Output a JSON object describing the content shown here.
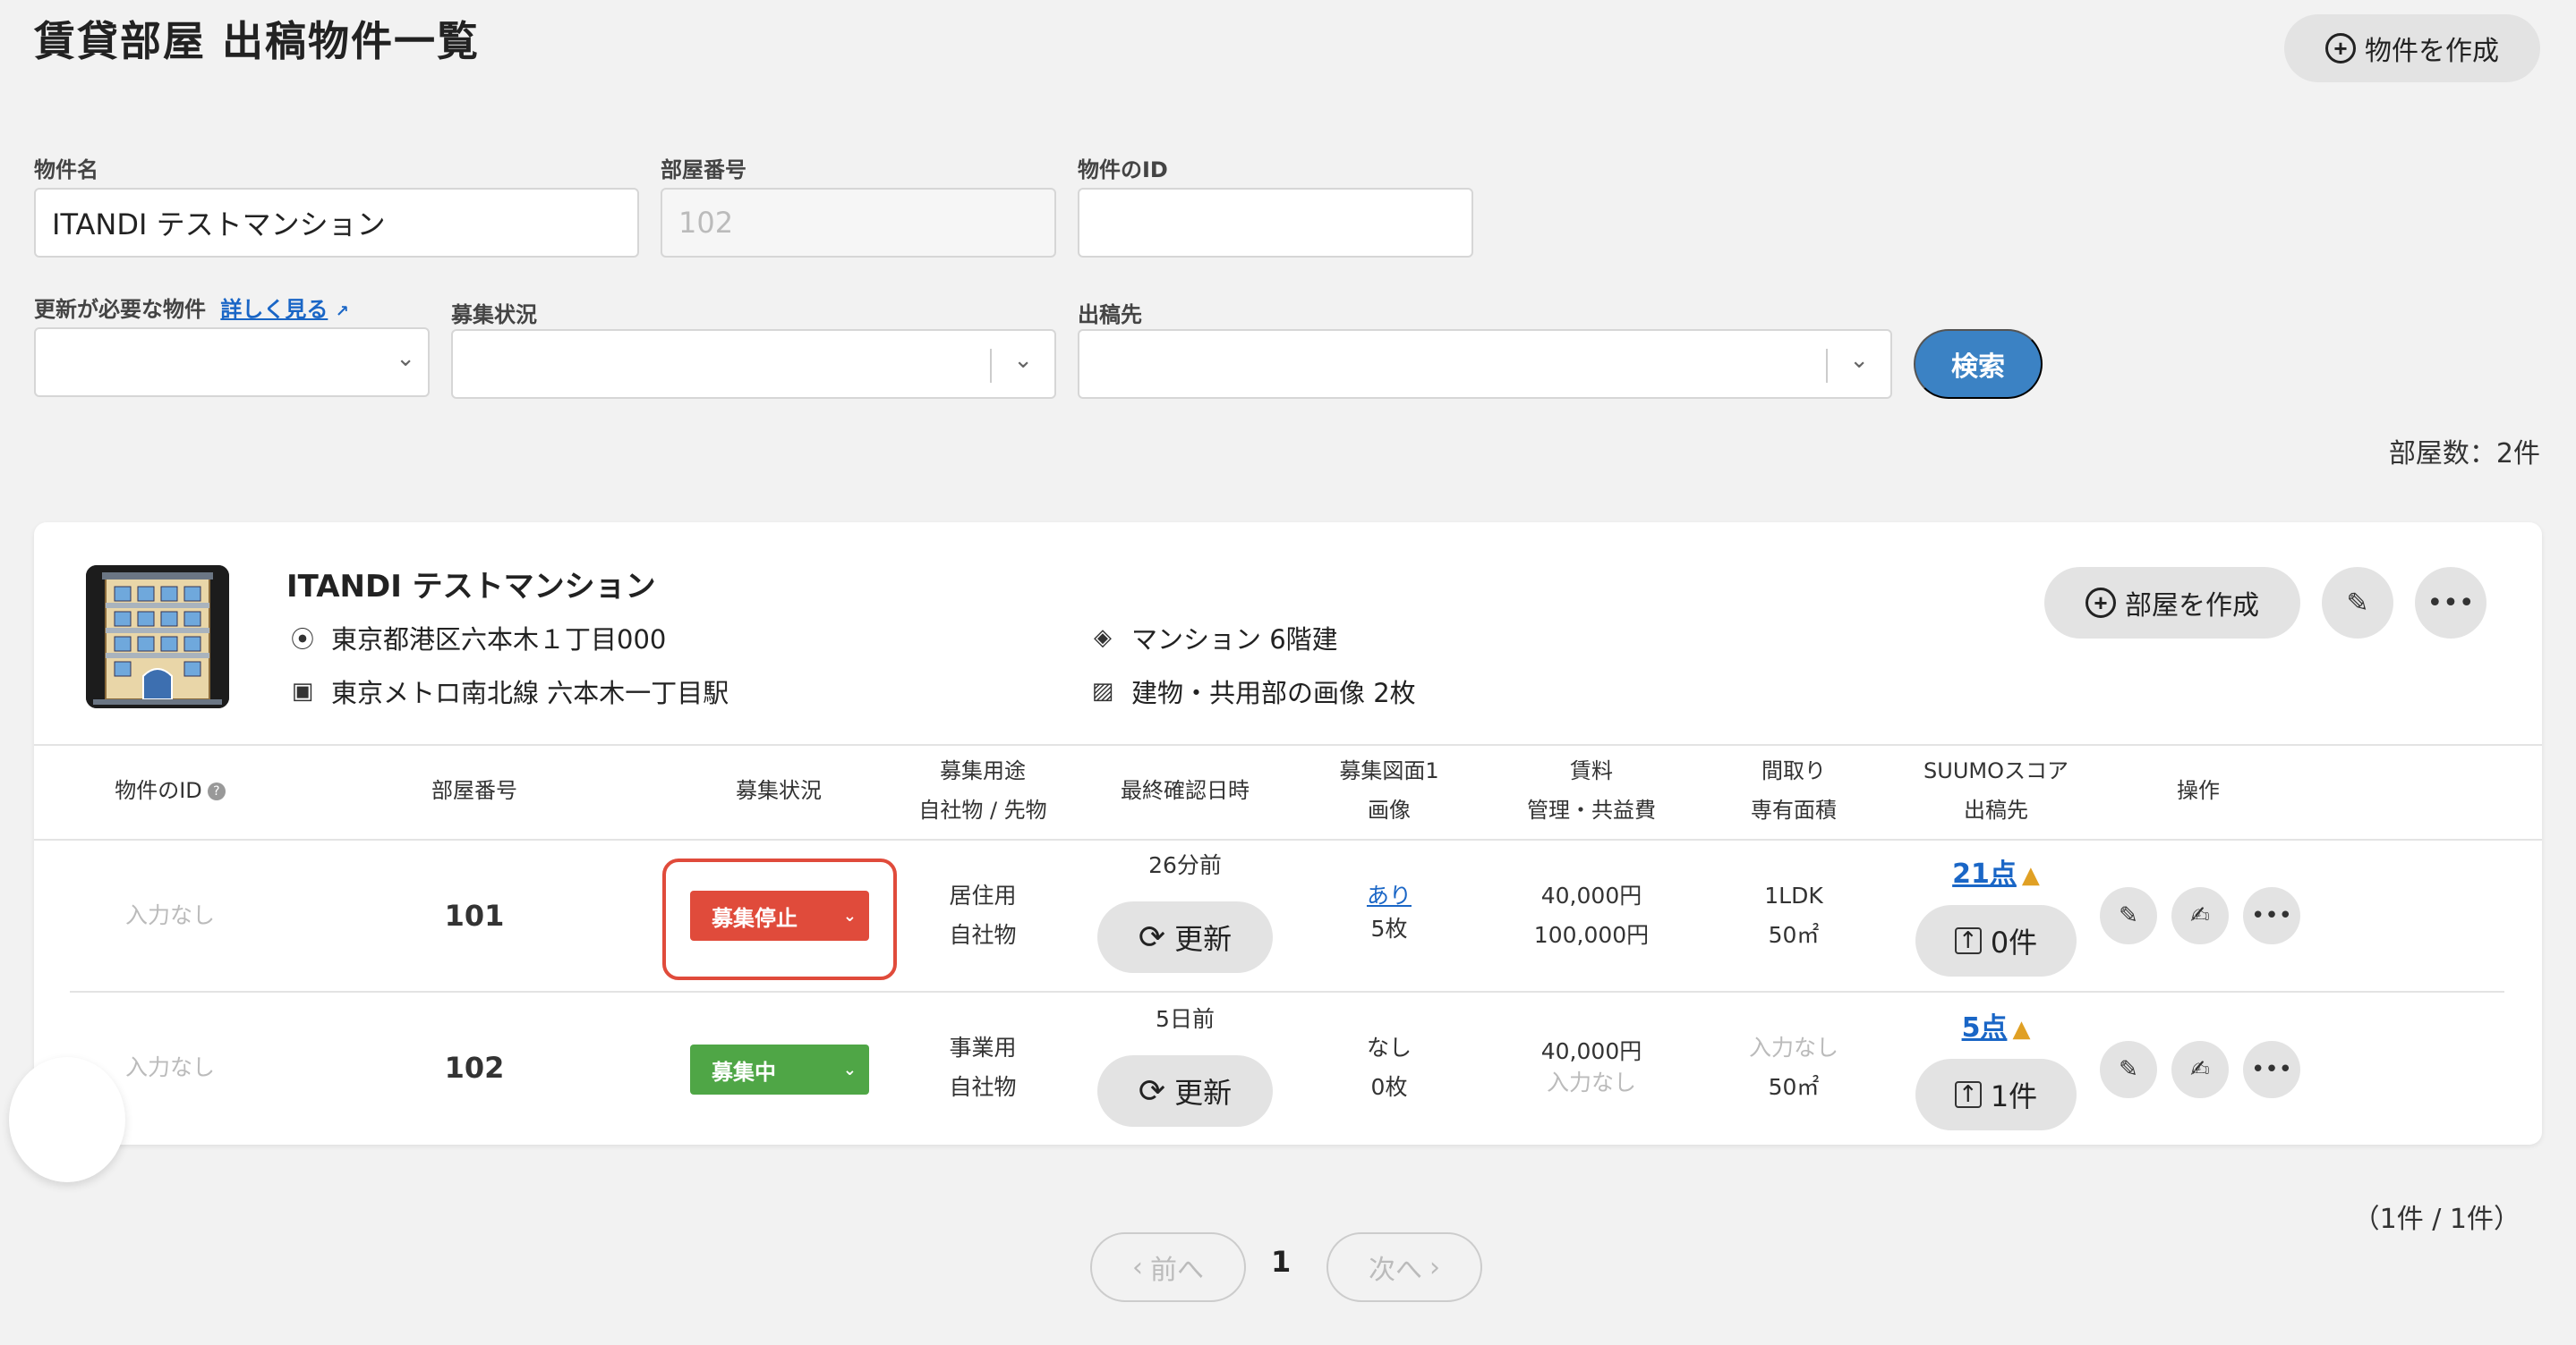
{
  "header": {
    "title": "賃貸部屋 出稿物件一覧",
    "create_property_label": "物件を作成"
  },
  "filters": {
    "property_name_label": "物件名",
    "property_name_value": "ITANDI テストマンション",
    "room_number_label": "部屋番号",
    "room_number_placeholder": "102",
    "property_id_label": "物件のID",
    "property_id_value": "",
    "needs_update_label": "更新が必要な物件",
    "details_link": "詳しく見る",
    "recruit_status_label": "募集状況",
    "publish_to_label": "出稿先",
    "search_label": "検索"
  },
  "room_count": "部屋数：2件",
  "property": {
    "name": "ITANDI テストマンション",
    "address": "東京都港区六本木１丁目000",
    "station": "東京メトロ南北線 六本木一丁目駅",
    "building_type": "マンション 6階建",
    "images": "建物・共用部の画像 2枚",
    "create_room_label": "部屋を作成"
  },
  "table": {
    "headers": {
      "property_id": "物件のID",
      "room_number": "部屋番号",
      "status": "募集状況",
      "usage_1": "募集用途",
      "usage_2": "自社物 / 先物",
      "last_checked": "最終確認日時",
      "floorplan_1": "募集図面1",
      "floorplan_2": "画像",
      "rent_1": "賃料",
      "rent_2": "管理・共益費",
      "layout_1": "間取り",
      "layout_2": "専有面積",
      "suumo_1": "SUUMOスコア",
      "suumo_2": "出稿先",
      "actions": "操作"
    },
    "rows": [
      {
        "property_id": "入力なし",
        "room_number": "101",
        "status": "募集停止",
        "usage": "居住用",
        "ownership": "自社物",
        "last_checked": "26分前",
        "update_label": "更新",
        "floorplan": "あり",
        "images": "5枚",
        "rent": "40,000円",
        "fee": "100,000円",
        "layout": "1LDK",
        "area": "50㎡",
        "score": "21点",
        "published": "0件"
      },
      {
        "property_id": "入力なし",
        "room_number": "102",
        "status": "募集中",
        "usage": "事業用",
        "ownership": "自社物",
        "last_checked": "5日前",
        "update_label": "更新",
        "floorplan": "なし",
        "images": "0枚",
        "rent": "40,000円",
        "fee": "入力なし",
        "layout": "入力なし",
        "area": "50㎡",
        "score": "5点",
        "published": "1件"
      }
    ]
  },
  "pagination": {
    "prev_label": "前へ",
    "next_label": "次へ",
    "current_page": "1",
    "info": "（1件 / 1件）"
  },
  "colors": {
    "primary": "#3b82c4",
    "status_stopped": "#e04b3b",
    "status_active": "#4fa646",
    "link": "#1a66c6",
    "warning": "#e0a024"
  }
}
